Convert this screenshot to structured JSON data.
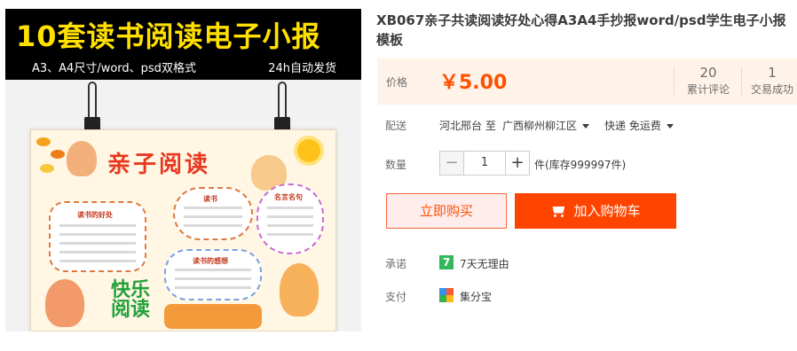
{
  "image": {
    "banner_title": "10套读书阅读电子小报",
    "banner_sub_left": "A3、A4尺寸/word、psd双格式",
    "banner_sub_right": "24h自动发货",
    "poster_title": "亲子阅读",
    "poster_label_1": "读书的好处",
    "poster_label_2": "名言名句",
    "poster_label_3": "读书的感想",
    "poster_label_4": "读书",
    "poster_happy": "快乐阅读"
  },
  "product": {
    "title": "XB067亲子共读阅读好处心得A3A4手抄报word/psd学生电子小报模板"
  },
  "price": {
    "label": "价格",
    "value": "￥5.00",
    "reviews_count": "20",
    "reviews_label": "累计评论",
    "sales_count": "1",
    "sales_label": "交易成功"
  },
  "shipping": {
    "label": "配送",
    "from": "河北邢台 至",
    "to": "广西柳州柳江区",
    "method": "快递 免运费"
  },
  "quantity": {
    "label": "数量",
    "minus": "−",
    "value": "1",
    "plus": "+",
    "stock": "件(库存999997件)"
  },
  "actions": {
    "buy_now": "立即购买",
    "add_to_cart": "加入购物车"
  },
  "promise": {
    "label": "承诺",
    "icon_text": "7",
    "text": "7天无理由"
  },
  "payment": {
    "label": "支付",
    "text": "集分宝"
  },
  "colors": {
    "accent": "#ff5000",
    "cart_button": "#ff4400",
    "price_bg": "#fff2e8",
    "promise_green": "#32b85a"
  },
  "icons": [
    "cart-icon",
    "seven-day-icon",
    "jifenbao-icon",
    "caret-down-icon",
    "binder-clip-icon"
  ]
}
